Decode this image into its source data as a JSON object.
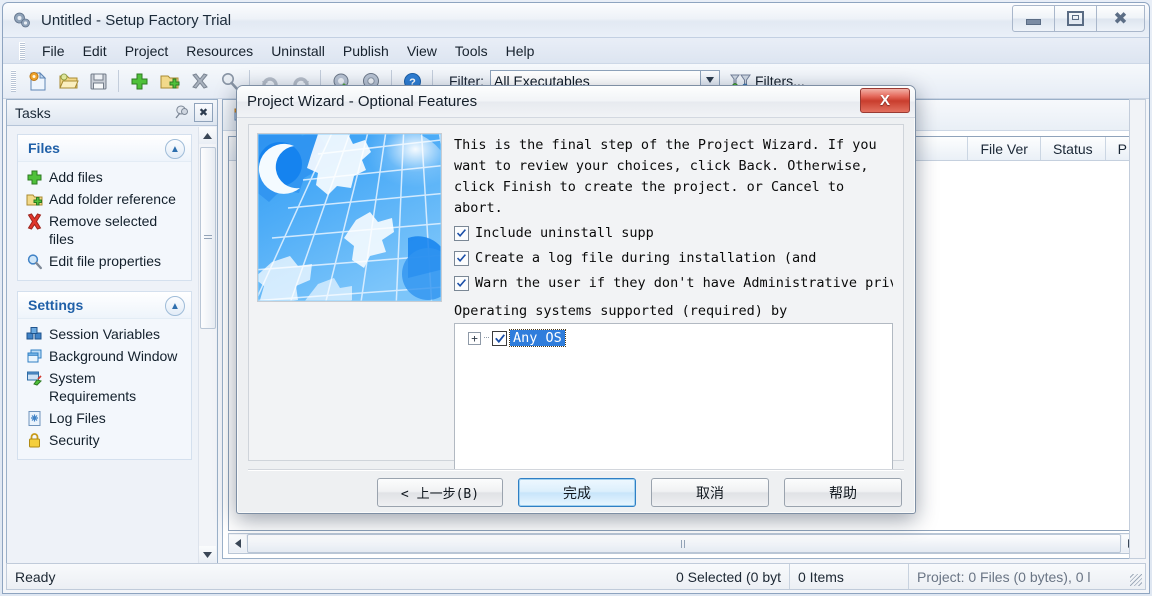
{
  "window": {
    "title": "Untitled - Setup Factory Trial",
    "app_icon": "gears-icon",
    "buttons": {
      "minimize": "minimize-icon",
      "maximize": "maximize-icon",
      "close": "close-icon"
    }
  },
  "menubar": {
    "items": [
      "File",
      "Edit",
      "Project",
      "Resources",
      "Uninstall",
      "Publish",
      "View",
      "Tools",
      "Help"
    ]
  },
  "toolbar": {
    "icons": [
      "new-project-icon",
      "open-project-icon",
      "save-project-icon",
      "add-files-icon",
      "add-folder-icon",
      "remove-files-icon",
      "find-icon",
      "undo-icon",
      "redo-icon",
      "build-settings-icon",
      "settings-icon",
      "help-icon"
    ],
    "filter_label": "Filter:",
    "filter_value": "All Executables",
    "filters_button": "Filters..."
  },
  "tasks_panel": {
    "title": "Tasks",
    "groups": [
      {
        "name": "Files",
        "items": [
          {
            "label": "Add files",
            "icon": "green-plus-icon"
          },
          {
            "label": "Add folder reference",
            "icon": "folder-plus-icon"
          },
          {
            "label": "Remove selected files",
            "icon": "red-x-icon"
          },
          {
            "label": "Edit file properties",
            "icon": "magnifier-icon"
          }
        ]
      },
      {
        "name": "Settings",
        "items": [
          {
            "label": "Session Variables",
            "icon": "blue-cubes-icon"
          },
          {
            "label": "Background Window",
            "icon": "windows-stack-icon"
          },
          {
            "label": "System Requirements",
            "icon": "system-check-icon"
          },
          {
            "label": "Log Files",
            "icon": "log-file-icon"
          },
          {
            "label": "Security",
            "icon": "padlock-icon"
          }
        ]
      }
    ]
  },
  "file_list": {
    "columns": [
      "File Ver",
      "Status",
      "P"
    ]
  },
  "statusbar": {
    "ready": "Ready",
    "selected": "0 Selected (0 byt",
    "items": "0 Items",
    "project": "Project: 0 Files (0 bytes), 0 l"
  },
  "dialog": {
    "title": "Project Wizard - Optional Features",
    "close_label": "X",
    "image_alt": "blue-gears-moon-graphic",
    "intro_text": "This is the final step of the Project Wizard. If you\nwant to review your choices, click Back. Otherwise,\nclick Finish to create the project. or Cancel to abort.",
    "checkboxes": [
      {
        "label": "Include uninstall supp",
        "checked": true
      },
      {
        "label": "Create a log file during installation (and",
        "checked": true
      },
      {
        "label": "Warn the user if they don't have Administrative priv",
        "checked": true
      }
    ],
    "os_label": "Operating systems supported (required) by",
    "os_tree": [
      {
        "label": "Any OS",
        "checked": true,
        "expandable": true,
        "selected": true
      }
    ],
    "buttons": {
      "back": "< 上一步(B)",
      "finish": "完成",
      "cancel": "取消",
      "help": "帮助"
    }
  },
  "colors": {
    "accent": "#2f7ddc",
    "titlebar": "#eef2f8",
    "close_red": "#c93d2d",
    "group_header": "#2060a8"
  }
}
